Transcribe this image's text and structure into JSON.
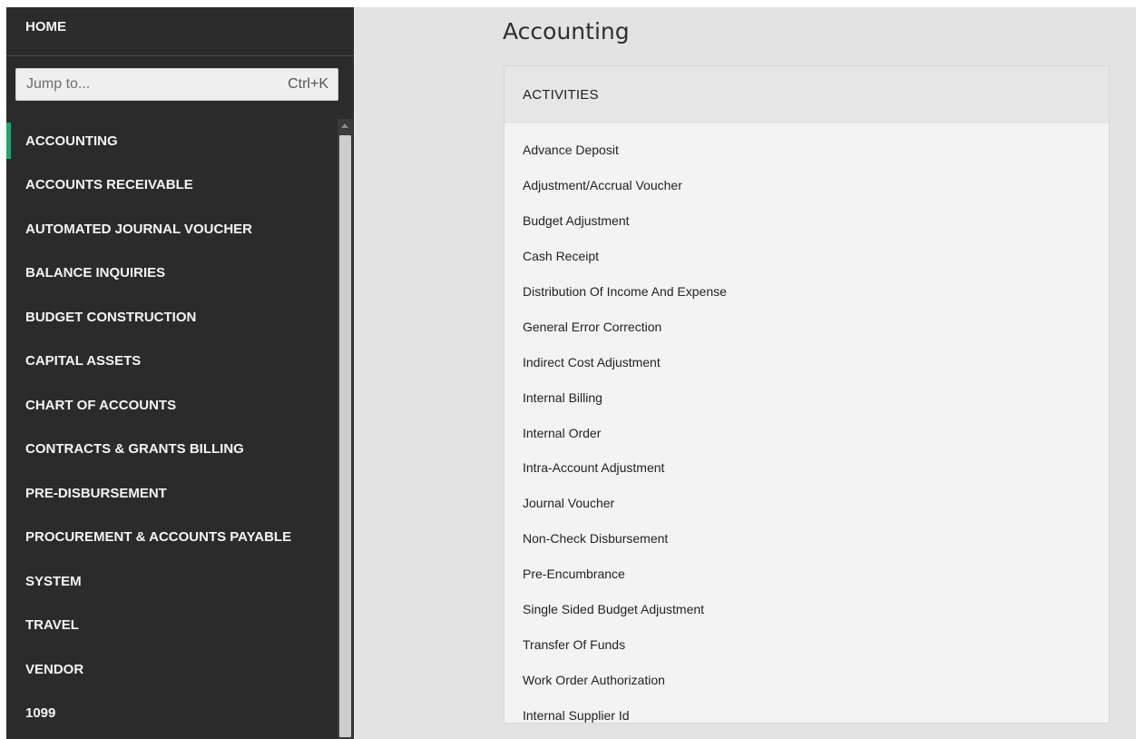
{
  "sidebar": {
    "home_label": "HOME",
    "jump": {
      "placeholder": "Jump to...",
      "shortcut": "Ctrl+K"
    },
    "items": [
      {
        "label": "ACCOUNTING",
        "active": true
      },
      {
        "label": "ACCOUNTS RECEIVABLE"
      },
      {
        "label": "AUTOMATED JOURNAL VOUCHER"
      },
      {
        "label": "BALANCE INQUIRIES"
      },
      {
        "label": "BUDGET CONSTRUCTION"
      },
      {
        "label": "CAPITAL ASSETS"
      },
      {
        "label": "CHART OF ACCOUNTS"
      },
      {
        "label": "CONTRACTS & GRANTS BILLING"
      },
      {
        "label": "PRE-DISBURSEMENT"
      },
      {
        "label": "PROCUREMENT & ACCOUNTS PAYABLE"
      },
      {
        "label": "SYSTEM"
      },
      {
        "label": "TRAVEL"
      },
      {
        "label": "VENDOR"
      },
      {
        "label": "1099"
      }
    ]
  },
  "main": {
    "title": "Accounting",
    "card": {
      "header": "ACTIVITIES",
      "activities": [
        "Advance Deposit",
        "Adjustment/Accrual Voucher",
        "Budget Adjustment",
        "Cash Receipt",
        "Distribution Of Income And Expense",
        "General Error Correction",
        "Indirect Cost Adjustment",
        "Internal Billing",
        "Internal Order",
        "Intra-Account Adjustment",
        "Journal Voucher",
        "Non-Check Disbursement",
        "Pre-Encumbrance",
        "Single Sided Budget Adjustment",
        "Transfer Of Funds",
        "Work Order Authorization",
        "Internal Supplier Id"
      ]
    }
  },
  "colors": {
    "sidebar_bg": "#2b2b2b",
    "active_accent": "#21a56b",
    "main_bg": "#e3e3e3"
  }
}
